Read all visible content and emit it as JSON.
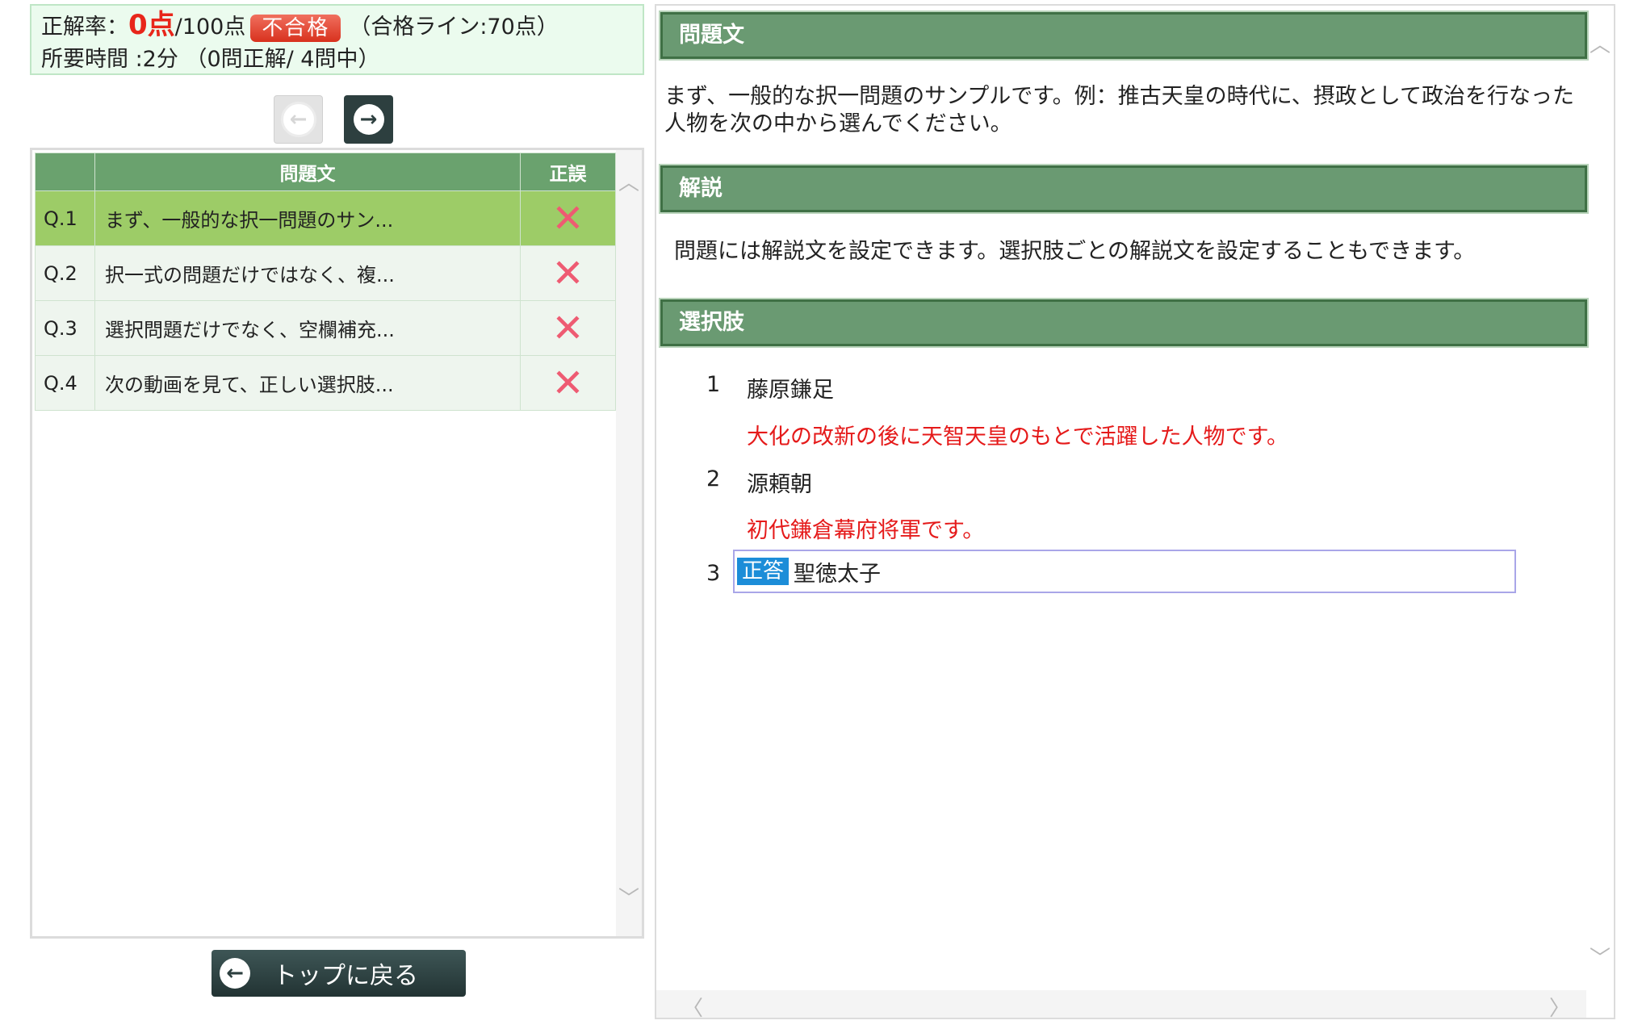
{
  "score": {
    "rate_label": "正解率：",
    "value": "0点",
    "max": "/100点",
    "badge": "不合格",
    "pass_line": "（合格ライン:70点）",
    "time_line": "所要時間 :2分 （0問正解/ 4問中）"
  },
  "nav": {
    "prev_icon": "arrow-left-icon",
    "next_icon": "arrow-right-icon"
  },
  "table": {
    "headers": [
      "",
      "問題文",
      "正誤"
    ],
    "rows": [
      {
        "num": "Q.1",
        "text": "まず、一般的な択一問題のサン...",
        "result": "✕"
      },
      {
        "num": "Q.2",
        "text": "択一式の問題だけではなく、複...",
        "result": "✕"
      },
      {
        "num": "Q.3",
        "text": "選択問題だけでなく、空欄補充...",
        "result": "✕"
      },
      {
        "num": "Q.4",
        "text": "次の動画を見て、正しい選択肢...",
        "result": "✕"
      }
    ]
  },
  "back_button": {
    "label": "トップに戻る"
  },
  "detail": {
    "question_header": "問題文",
    "question_text": "まず、一般的な択一問題のサンプルです。例：推古天皇の時代に、摂政として政治を行なった人物を次の中から選んでください。",
    "explanation_header": "解説",
    "explanation_text": "問題には解説文を設定できます。選択肢ごとの解説文を設定することもできます。",
    "choices_header": "選択肢",
    "choices": [
      {
        "num": "1",
        "text": "藤原鎌足",
        "explanation": "大化の改新の後に天智天皇のもとで活躍した人物です。"
      },
      {
        "num": "2",
        "text": "源頼朝",
        "explanation": "初代鎌倉幕府将軍です。"
      },
      {
        "num": "3",
        "text": "聖徳太子",
        "tag": "正答"
      }
    ]
  },
  "colors": {
    "header_green": "#6a9a72",
    "selected_row": "#9dcc67",
    "fail_red": "#e8261a",
    "correct_blue": "#1c8dd8"
  }
}
